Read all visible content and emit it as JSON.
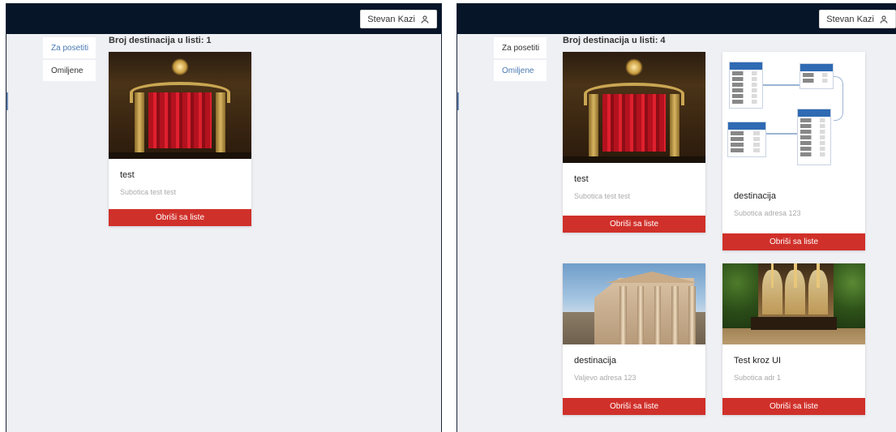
{
  "user": {
    "name": "Stevan Kazi",
    "icon": "user-icon"
  },
  "sidebar": {
    "items": [
      {
        "label": "Za posetiti"
      },
      {
        "label": "Omiljene"
      }
    ]
  },
  "left_screen": {
    "count_label": "Broj destinacija u listi: 1",
    "active_tab": "Za posetiti",
    "cards": [
      {
        "title": "test",
        "subtitle": "Subotica test test",
        "button": "Obriši sa liste",
        "image": "theater-image"
      }
    ]
  },
  "right_screen": {
    "count_label": "Broj destinacija u listi: 4",
    "active_tab": "Omiljene",
    "cards": [
      {
        "title": "test",
        "subtitle": "Subotica test test",
        "button": "Obriši sa liste",
        "image": "theater-image"
      },
      {
        "title": "destinacija",
        "subtitle": "Subotica adresa 123",
        "button": "Obriši sa liste",
        "image": "database-diagram-image"
      },
      {
        "title": "destinacija",
        "subtitle": "Valjevo adresa 123",
        "button": "Obriši sa liste",
        "image": "building-image"
      },
      {
        "title": "Test kroz UI",
        "subtitle": "Subotica adr 1",
        "button": "Obriši sa liste",
        "image": "restaurant-image"
      }
    ]
  },
  "colors": {
    "topbar": "#071528",
    "background": "#eff0f4",
    "remove_button": "#d0302a",
    "active_tab": "#4a78b3"
  }
}
